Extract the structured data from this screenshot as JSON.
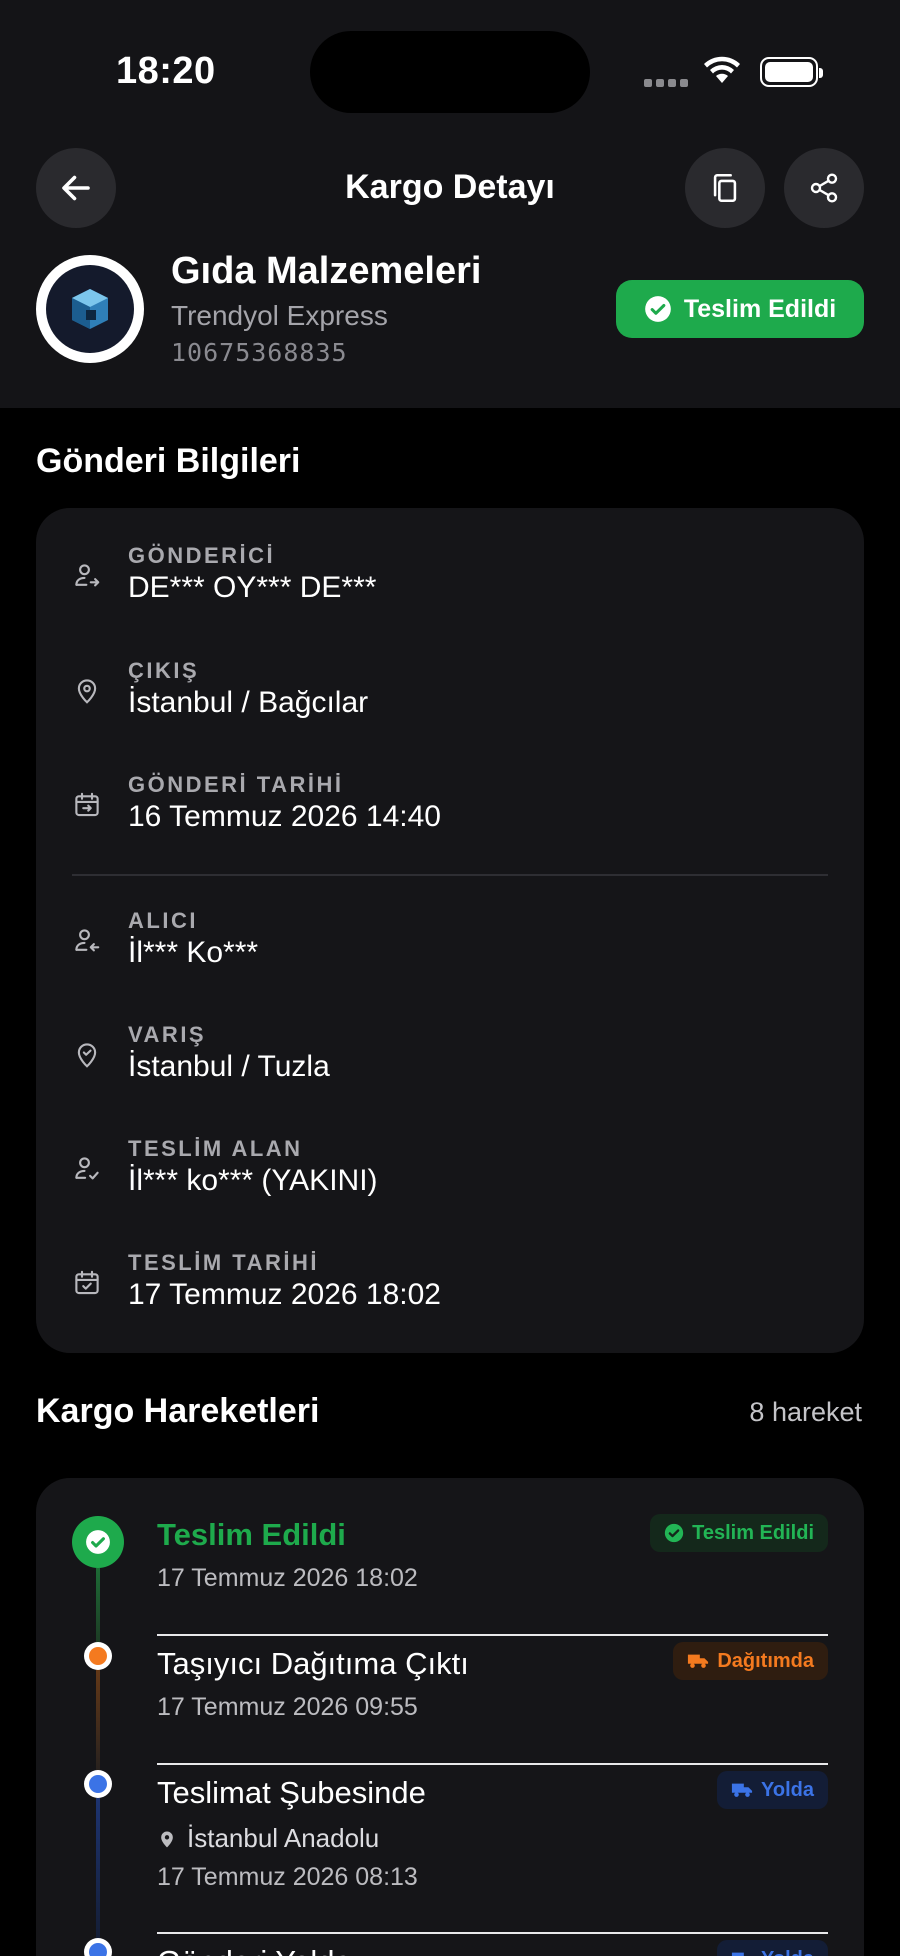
{
  "status_bar": {
    "time": "18:20"
  },
  "header": {
    "title": "Kargo Detayı",
    "back_icon": "arrow-left-icon",
    "copy_icon": "copy-icon",
    "share_icon": "share-icon"
  },
  "package": {
    "title": "Gıda Malzemeleri",
    "carrier": "Trendyol Express",
    "tracking_number": "10675368835",
    "status": "Teslim Edildi",
    "status_color": "#1eaa4c"
  },
  "info": {
    "section_title": "Gönderi Bilgileri",
    "rows": [
      {
        "icon": "user-send-icon",
        "label": "GÖNDERİCİ",
        "value": "DE*** OY*** DE***"
      },
      {
        "icon": "map-pin-icon",
        "label": "ÇIKIŞ",
        "value": "İstanbul / Bağcılar"
      },
      {
        "icon": "calendar-arrow-icon",
        "label": "GÖNDERİ TARİHİ",
        "value": "16 Temmuz 2026 14:40"
      },
      {
        "icon": "user-receive-icon",
        "label": "ALICI",
        "value": "İl*** Ko***"
      },
      {
        "icon": "map-pin-check-icon",
        "label": "VARIŞ",
        "value": "İstanbul / Tuzla"
      },
      {
        "icon": "user-check-icon",
        "label": "TESLİM ALAN",
        "value": "İl*** ko*** (YAKINI)"
      },
      {
        "icon": "calendar-check-icon",
        "label": "TESLİM TARİHİ",
        "value": "17 Temmuz 2026 18:02"
      }
    ]
  },
  "movements": {
    "section_title": "Kargo Hareketleri",
    "count_label": "8 hareket",
    "items": [
      {
        "title": "Teslim Edildi",
        "date": "17 Temmuz 2026 18:02",
        "badge": "Teslim Edildi",
        "badge_color": "#22b555"
      },
      {
        "title": "Taşıyıcı Dağıtıma Çıktı",
        "date": "17 Temmuz 2026 09:55",
        "badge": "Dağıtımda",
        "badge_color": "#f47a1f"
      },
      {
        "title": "Teslimat Şubesinde",
        "location": "İstanbul Anadolu",
        "date": "17 Temmuz 2026 08:13",
        "badge": "Yolda",
        "badge_color": "#3b73e6"
      },
      {
        "title": "Gönderi Yolda",
        "badge": "Yolda",
        "badge_color": "#3b73e6"
      }
    ]
  }
}
